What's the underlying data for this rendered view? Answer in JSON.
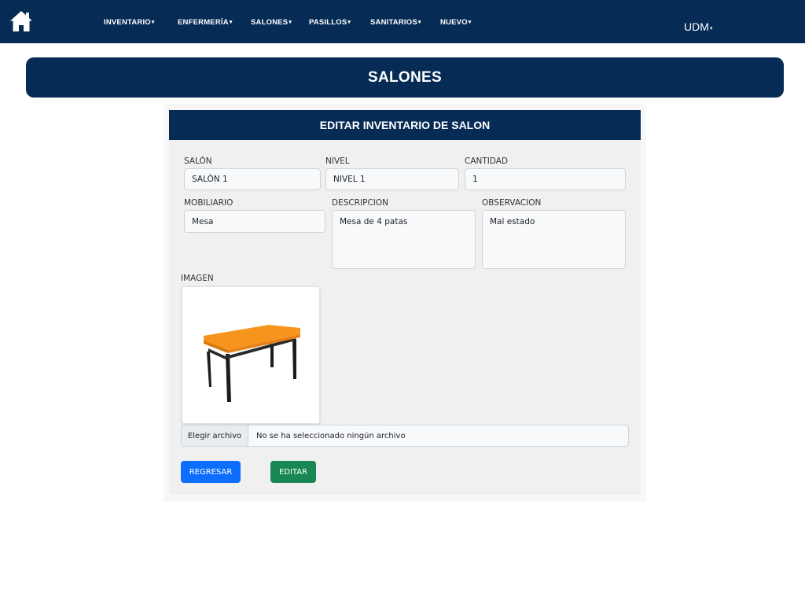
{
  "nav": {
    "home_icon": "home-icon",
    "items": [
      {
        "label": "INVENTARIO"
      },
      {
        "label": "ENFERMERÍA"
      },
      {
        "label": "SALONES"
      },
      {
        "label": "PASILLOS"
      },
      {
        "label": "SANITARIOS"
      },
      {
        "label": "NUEVO"
      }
    ],
    "caret": "▾",
    "user": "UDM",
    "user_caret": "▾"
  },
  "section": {
    "title": "SALONES"
  },
  "form": {
    "title": "EDITAR INVENTARIO DE SALON",
    "fields": {
      "salon": {
        "label": "SALÓN",
        "value": "SALÓN 1"
      },
      "nivel": {
        "label": "NIVEL",
        "value": "NIVEL 1"
      },
      "cantidad": {
        "label": "CANTIDAD",
        "value": "1"
      },
      "mobiliario": {
        "label": "MOBILIARIO",
        "value": "Mesa"
      },
      "descripcion": {
        "label": "DESCRIPCION",
        "value": "Mesa de 4 patas"
      },
      "observacion": {
        "label": "OBSERVACION",
        "value": "Mal estado"
      }
    },
    "image": {
      "label": "IMAGEN",
      "icon": "table-image"
    },
    "file": {
      "button": "Elegir archivo",
      "status": "No se ha seleccionado ningún archivo"
    },
    "buttons": {
      "back": "REGRESAR",
      "edit": "EDITAR"
    }
  },
  "colors": {
    "navy": "#062c55",
    "primary": "#0d6efd",
    "success": "#198754",
    "table_top": "#f7941d"
  }
}
